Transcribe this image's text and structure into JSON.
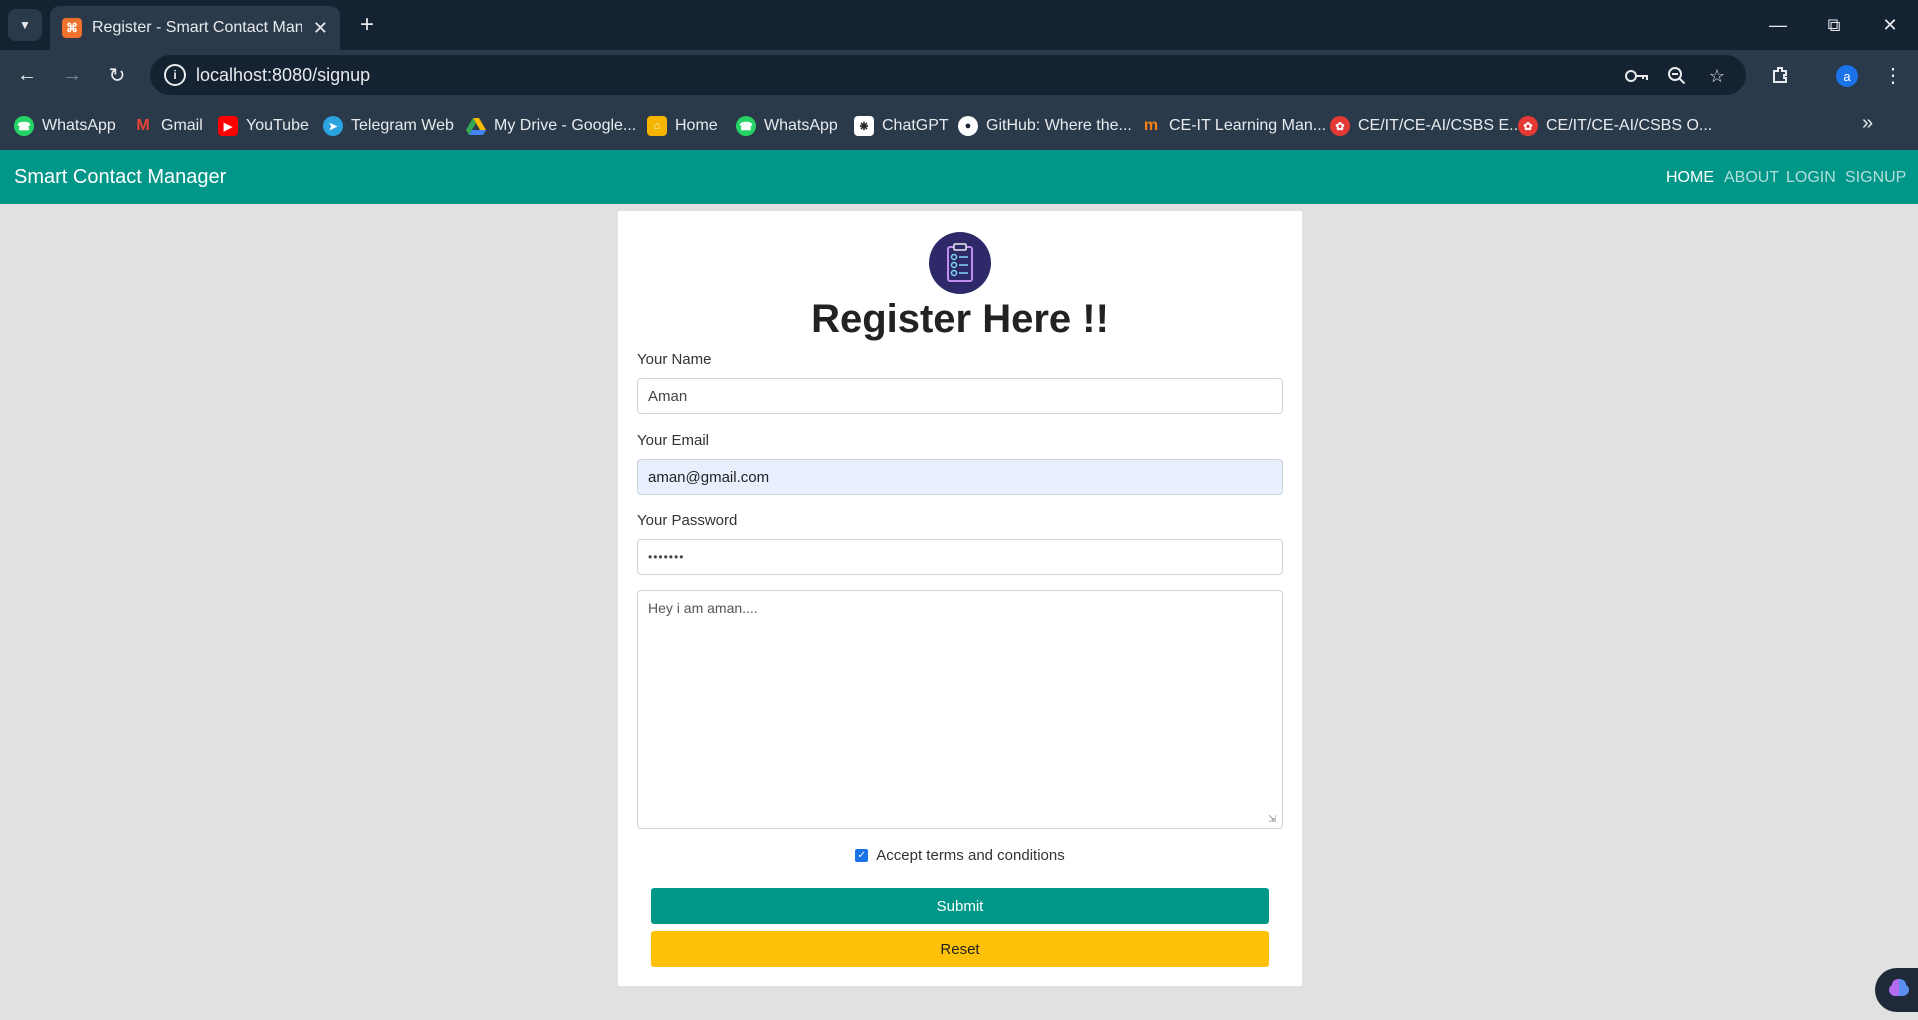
{
  "browser": {
    "tab_title": "Register - Smart Contact Manag",
    "url": "localhost:8080/signup",
    "profile_initial": "a",
    "bookmarks": [
      {
        "label": "WhatsApp",
        "icon": "whatsapp-icon",
        "color": "#25d366"
      },
      {
        "label": "Gmail",
        "icon": "gmail-icon",
        "color": "#ea4335"
      },
      {
        "label": "YouTube",
        "icon": "youtube-icon",
        "color": "#ff0000"
      },
      {
        "label": "Telegram Web",
        "icon": "telegram-icon",
        "color": "#2aa3df"
      },
      {
        "label": "My Drive - Google...",
        "icon": "google-drive-icon",
        "color": "#34a853"
      },
      {
        "label": "Home",
        "icon": "home-icon",
        "color": "#f4b400"
      },
      {
        "label": "WhatsApp",
        "icon": "whatsapp-icon",
        "color": "#25d366"
      },
      {
        "label": "ChatGPT",
        "icon": "chatgpt-icon",
        "color": "#ffffff"
      },
      {
        "label": "GitHub: Where the...",
        "icon": "github-icon",
        "color": "#ffffff"
      },
      {
        "label": "CE-IT Learning Man...",
        "icon": "moodle-icon",
        "color": "#f98012"
      },
      {
        "label": "CE/IT/CE-AI/CSBS E...",
        "icon": "college-icon",
        "color": "#e53935"
      },
      {
        "label": "CE/IT/CE-AI/CSBS O...",
        "icon": "college-icon",
        "color": "#e53935"
      }
    ]
  },
  "navbar": {
    "brand": "Smart Contact Manager",
    "links": [
      "HOME",
      "ABOUT",
      "LOGIN",
      "SIGNUP"
    ],
    "color": "#009688"
  },
  "form": {
    "title": "Register Here !!",
    "name_label": "Your Name",
    "name_value": "Aman",
    "email_label": "Your Email",
    "email_value": "aman@gmail.com",
    "password_label": "Your Password",
    "password_value": "•••••••",
    "about_value": "Hey i am aman....",
    "terms_label": "Accept terms and conditions",
    "terms_checked": true,
    "submit_label": "Submit",
    "reset_label": "Reset"
  }
}
